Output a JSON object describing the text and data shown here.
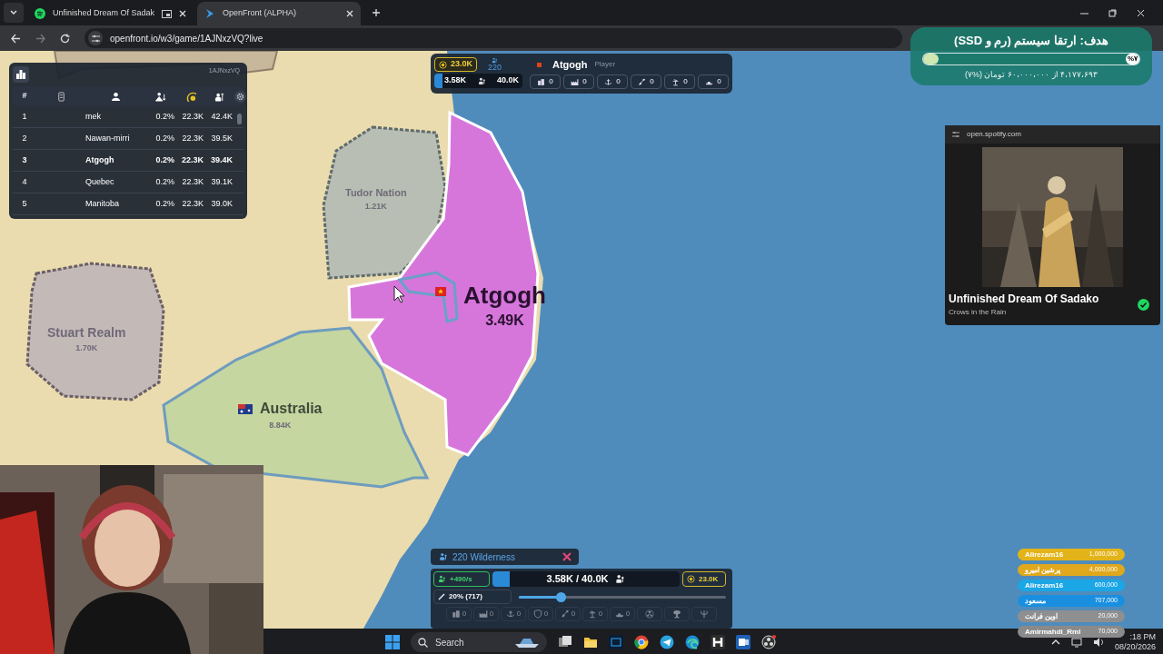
{
  "browser": {
    "tabs": [
      {
        "title": "Unfinished Dream Of Sadak",
        "kind": "music",
        "selected": false
      },
      {
        "title": "OpenFront (ALPHA)",
        "kind": "game",
        "selected": true
      }
    ],
    "url": "openfront.io/w3/game/1AJNxzVQ?live"
  },
  "leaderboard": {
    "game_id": "1AJNxzVQ",
    "columns": [
      "#"
    ],
    "rows": [
      {
        "rank": "1",
        "name": "mek",
        "tiles": "0.2%",
        "gold": "22.3K",
        "troops": "42.4K",
        "selected": false
      },
      {
        "rank": "2",
        "name": "Nawan-mirri",
        "tiles": "0.2%",
        "gold": "22.3K",
        "troops": "39.5K",
        "selected": false
      },
      {
        "rank": "3",
        "name": "Atgogh",
        "tiles": "0.2%",
        "gold": "22.3K",
        "troops": "39.4K",
        "selected": true
      },
      {
        "rank": "4",
        "name": "Quebec",
        "tiles": "0.2%",
        "gold": "22.3K",
        "troops": "39.1K",
        "selected": false
      },
      {
        "rank": "5",
        "name": "Manitoba",
        "tiles": "0.2%",
        "gold": "22.3K",
        "troops": "39.0K",
        "selected": false
      }
    ]
  },
  "player_bar": {
    "gold": "23.0K",
    "workers": "220",
    "name": "Atgogh",
    "role": "Player",
    "troops": "3.58K",
    "max_troops": "40.0K",
    "level": 0.09,
    "buildings": [
      {
        "kind": "city",
        "count": "0"
      },
      {
        "kind": "factory",
        "count": "0"
      },
      {
        "kind": "port",
        "count": "0"
      },
      {
        "kind": "missile",
        "count": "0"
      },
      {
        "kind": "sam",
        "count": "0"
      },
      {
        "kind": "warship",
        "count": "0"
      }
    ]
  },
  "map": {
    "labels": [
      {
        "name": "Tudor Nation",
        "troops": "1.21K",
        "kind": "nation"
      },
      {
        "name": "Stuart Realm",
        "troops": "1.70K",
        "kind": "nation"
      },
      {
        "name": "Australia",
        "troops": "8.84K",
        "kind": "flagged"
      },
      {
        "name": "Atgogh",
        "troops": "3.49K",
        "kind": "player"
      }
    ]
  },
  "goal": {
    "title": "هدف: ارتقا سیستم (رم و SSD)",
    "percent": "%۷",
    "level": 0.07,
    "subtitle": "۴،۱۷۷،۶۹۳ از ۶۰،۰۰۰،۰۰۰ تومان (%۷)"
  },
  "spotify": {
    "domain": "open.spotify.com",
    "title": "Unfinished Dream Of Sadako",
    "artist": "Crows in the Rain",
    "saved": true
  },
  "control_panel": {
    "target": "220 Wilderness",
    "rate": "+490/s",
    "troops_bar": {
      "text": "3.58K / 40.0K",
      "level": 0.09
    },
    "gold": "23.0K",
    "ratio_slider": {
      "label": "20% (717)",
      "level": 0.2
    },
    "build_bar": [
      {
        "kind": "city",
        "count": "0"
      },
      {
        "kind": "factory",
        "count": "0"
      },
      {
        "kind": "port",
        "count": "0"
      },
      {
        "kind": "defense",
        "count": "0"
      },
      {
        "kind": "missile",
        "count": "0"
      },
      {
        "kind": "sam",
        "count": "0"
      },
      {
        "kind": "warship",
        "count": "0"
      },
      {
        "kind": "nuke"
      },
      {
        "kind": "hydrogen"
      },
      {
        "kind": "mirv"
      }
    ]
  },
  "donations": [
    {
      "name": "Alirezam16",
      "amount": "1,000,000",
      "color": "#e3b419"
    },
    {
      "name": "پرشین امیرو",
      "amount": "4,000,000",
      "color": "#e0a81c"
    },
    {
      "name": "Alirezam16",
      "amount": "600,000",
      "color": "#1ba6e6"
    },
    {
      "name": "مسعود",
      "amount": "707,000",
      "color": "#1a8fe0"
    },
    {
      "name": "اوین فرانت",
      "amount": "20,000",
      "color": "#8f8f8f"
    },
    {
      "name": "Amirmahdi_Rml",
      "amount": "70,000",
      "color": "#8a8a8a"
    }
  ],
  "taskbar": {
    "search": "Search",
    "time": ":18 PM",
    "date": "08/20/2026"
  }
}
